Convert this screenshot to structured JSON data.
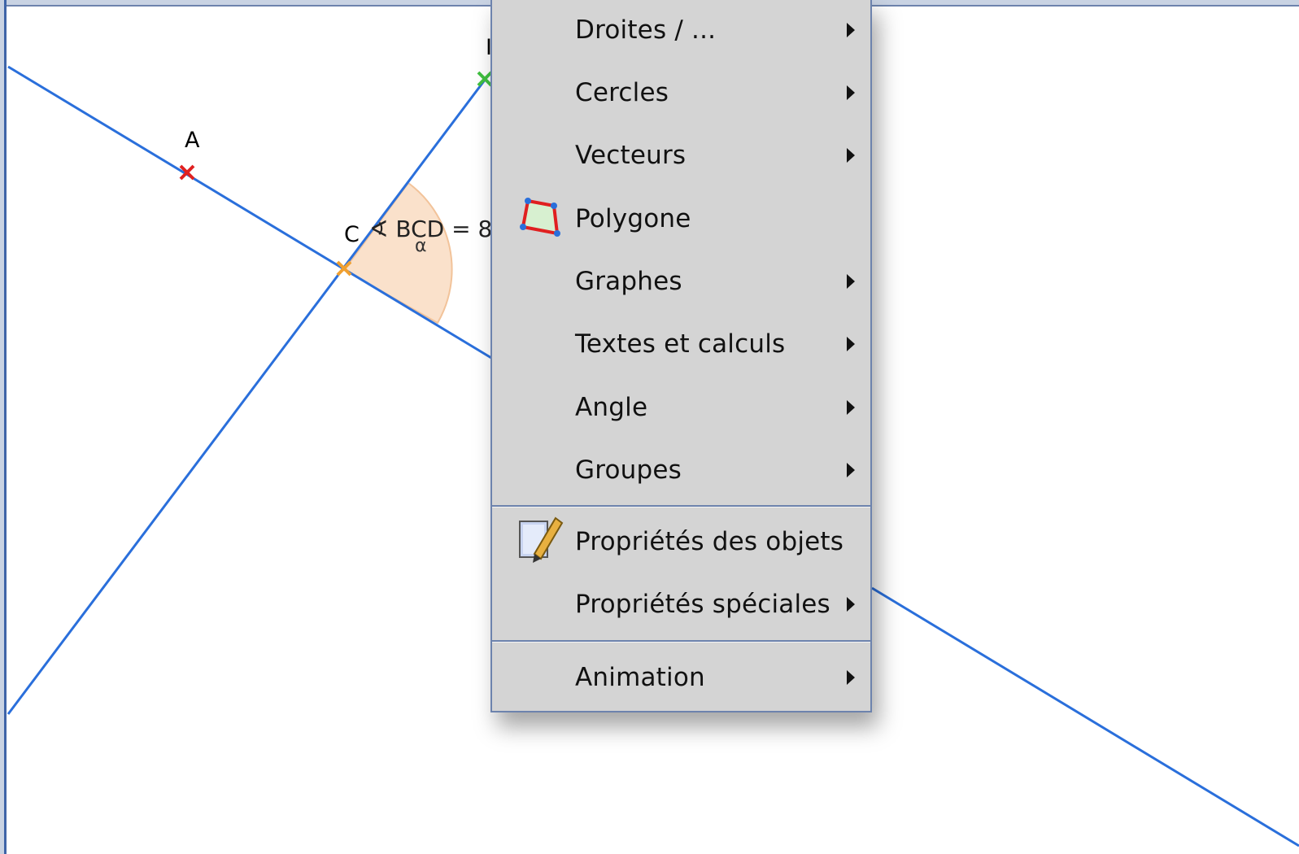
{
  "points": {
    "a": "A",
    "c": "C",
    "b_partial": "I"
  },
  "angle": {
    "label": "∢ BCD = 8",
    "symbol": "α"
  },
  "menu": {
    "items": [
      {
        "label": "Droites / ...",
        "submenu": true
      },
      {
        "label": "Cercles",
        "submenu": true
      },
      {
        "label": "Vecteurs",
        "submenu": true
      },
      {
        "label": "Polygone",
        "submenu": false,
        "icon": "polygon-icon"
      },
      {
        "label": "Graphes",
        "submenu": true
      },
      {
        "label": "Textes et calculs",
        "submenu": true
      },
      {
        "label": "Angle",
        "submenu": true
      },
      {
        "label": "Groupes",
        "submenu": true
      },
      {
        "label": "Propriétés des objets",
        "submenu": false,
        "icon": "edit-properties-icon"
      },
      {
        "label": "Propriétés spéciales",
        "submenu": true
      },
      {
        "label": "Animation",
        "submenu": true
      }
    ]
  },
  "colors": {
    "line": "#2a6fdb",
    "point_a": "#e02020",
    "point_c": "#f0a030",
    "point_b": "#40c040",
    "angle_fill": "#f9dcc2",
    "menu_bg": "#d4d4d4",
    "menu_border": "#6d83ad"
  }
}
